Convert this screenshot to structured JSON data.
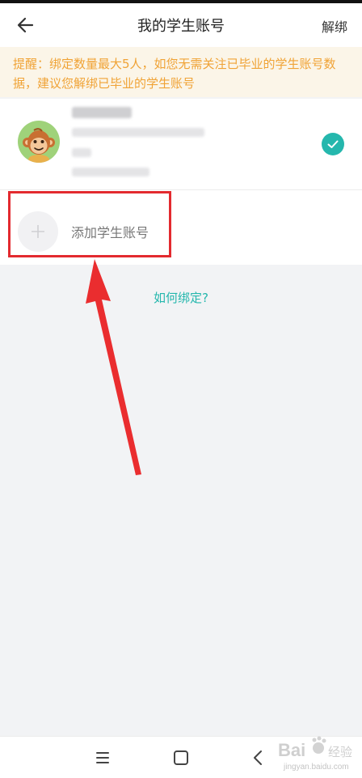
{
  "header": {
    "title": "我的学生账号",
    "unbind_label": "解绑"
  },
  "notice": {
    "text": "提醒：绑定数量最大5人，如您无需关注已毕业的学生账号数据，建议您解绑已毕业的学生账号"
  },
  "student": {
    "avatar_icon": "monkey-avatar-icon",
    "selected": true
  },
  "add_student": {
    "label": "添加学生账号"
  },
  "help_link": "如何绑定?",
  "watermark": {
    "text": "jingyan.baidu.com"
  },
  "colors": {
    "accent": "#25b7ad",
    "notice_text": "#f0a336",
    "notice_bg": "#fbf5e8",
    "annotation_red": "#e32a2f"
  }
}
